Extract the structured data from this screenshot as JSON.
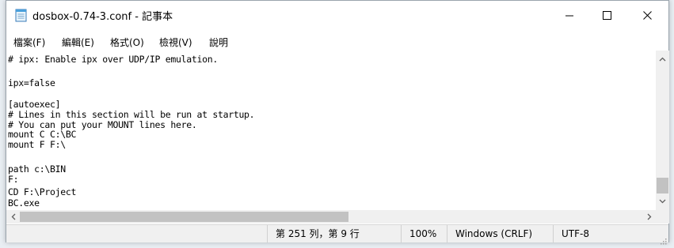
{
  "window": {
    "title": "dosbox-0.74-3.conf - 記事本",
    "minimize_symbol": "—",
    "close_symbol": "✕"
  },
  "menu": {
    "items": [
      "檔案(F)",
      "編輯(E)",
      "格式(O)",
      "檢視(V)",
      "說明"
    ]
  },
  "editor": {
    "lines": [
      "# ipx: Enable ipx over UDP/IP emulation.",
      "",
      "ipx=false",
      "",
      "[autoexec]",
      "# Lines in this section will be run at startup.",
      "# You can put your MOUNT lines here.",
      "mount C C:\\BC",
      "mount F F:\\",
      "path c:\\BIN",
      "F:",
      "CD F:\\Project",
      "BC.exe"
    ]
  },
  "statusbar": {
    "position": "第 251 列，第 9 行",
    "zoom": "100%",
    "line_ending": "Windows (CRLF)",
    "encoding": "UTF-8"
  },
  "icons": {
    "app": "notepad-icon",
    "scroll_up": "chevron-up-icon",
    "scroll_down": "chevron-down-icon",
    "scroll_left": "chevron-left-icon",
    "scroll_right": "chevron-right-icon"
  }
}
